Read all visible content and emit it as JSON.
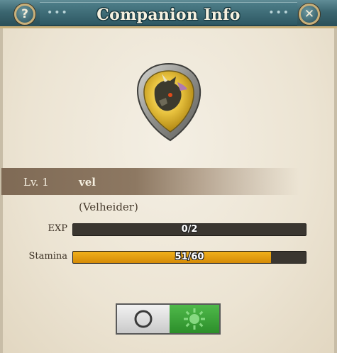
{
  "header": {
    "title": "Companion Info",
    "help_label": "?",
    "close_label": "✕",
    "decor_dots": "•••"
  },
  "companion": {
    "level": "Lv. 1",
    "name": "vel",
    "species": "(Velheider)"
  },
  "stats": {
    "exp_label": "EXP",
    "exp_value": "0/2",
    "exp_fraction": 0,
    "stamina_label": "Stamina",
    "stamina_value": "51/60",
    "stamina_fraction": 0.85
  },
  "toggle": {
    "state": "on",
    "off_icon": "circle-icon",
    "on_icon": "sun-icon"
  },
  "colors": {
    "header": "#3b6670",
    "gold_trim": "#c9b07a",
    "bar_fill": "#e8a214",
    "toggle_on": "#3da23a"
  }
}
